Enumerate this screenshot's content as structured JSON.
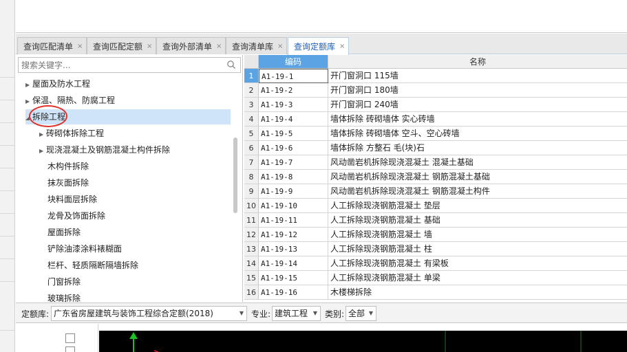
{
  "tabs": [
    {
      "label": "查询匹配清单",
      "active": false
    },
    {
      "label": "查询匹配定额",
      "active": false
    },
    {
      "label": "查询外部清单",
      "active": false
    },
    {
      "label": "查询清单库",
      "active": false
    },
    {
      "label": "查询定额库",
      "active": true
    }
  ],
  "tab_close_glyph": "×",
  "search": {
    "placeholder": "搜索关键字..."
  },
  "tree": [
    {
      "label": "屋面及防水工程",
      "level": 1,
      "expandable": true,
      "expanded": false
    },
    {
      "label": "保温、隔热、防腐工程",
      "level": 1,
      "expandable": true,
      "expanded": false
    },
    {
      "label": "拆除工程",
      "level": 1,
      "expandable": true,
      "expanded": true,
      "selected": true
    },
    {
      "label": "砖砌体拆除工程",
      "level": 2,
      "expandable": true,
      "expanded": false
    },
    {
      "label": "现浇混凝土及钢筋混凝土构件拆除",
      "level": 2,
      "expandable": true,
      "expanded": false
    },
    {
      "label": "木构件拆除",
      "level": 2,
      "expandable": false
    },
    {
      "label": "抹灰面拆除",
      "level": 2,
      "expandable": false
    },
    {
      "label": "块料面层拆除",
      "level": 2,
      "expandable": false
    },
    {
      "label": "龙骨及饰面拆除",
      "level": 2,
      "expandable": false
    },
    {
      "label": "屋面拆除",
      "level": 2,
      "expandable": false
    },
    {
      "label": "铲除油漆涂料裱糊面",
      "level": 2,
      "expandable": false
    },
    {
      "label": "栏杆、轻质隔断隔墙拆除",
      "level": 2,
      "expandable": false
    },
    {
      "label": "门窗拆除",
      "level": 2,
      "expandable": false
    },
    {
      "label": "玻璃拆除",
      "level": 2,
      "expandable": false
    }
  ],
  "grid": {
    "headers": {
      "code": "编码",
      "name": "名称"
    },
    "rows": [
      {
        "num": "1",
        "code": "A1-19-1",
        "name": "开门窗洞口 115墙"
      },
      {
        "num": "2",
        "code": "A1-19-2",
        "name": "开门窗洞口 180墙"
      },
      {
        "num": "3",
        "code": "A1-19-3",
        "name": "开门窗洞口 240墙"
      },
      {
        "num": "4",
        "code": "A1-19-4",
        "name": "墙体拆除 砖砌墙体 实心砖墙"
      },
      {
        "num": "5",
        "code": "A1-19-5",
        "name": "墙体拆除 砖砌墙体 空斗、空心砖墙"
      },
      {
        "num": "6",
        "code": "A1-19-6",
        "name": "墙体拆除 方整石 毛(块)石"
      },
      {
        "num": "7",
        "code": "A1-19-7",
        "name": "风动凿岩机拆除现浇混凝土 混凝土基础"
      },
      {
        "num": "8",
        "code": "A1-19-8",
        "name": "风动凿岩机拆除现浇混凝土 钢筋混凝土基础"
      },
      {
        "num": "9",
        "code": "A1-19-9",
        "name": "风动凿岩机拆除现浇混凝土 钢筋混凝土构件"
      },
      {
        "num": "10",
        "code": "A1-19-10",
        "name": "人工拆除现浇钢筋混凝土 垫层"
      },
      {
        "num": "11",
        "code": "A1-19-11",
        "name": "人工拆除现浇钢筋混凝土 基础"
      },
      {
        "num": "12",
        "code": "A1-19-12",
        "name": "人工拆除现浇钢筋混凝土 墙"
      },
      {
        "num": "13",
        "code": "A1-19-13",
        "name": "人工拆除现浇钢筋混凝土 柱"
      },
      {
        "num": "14",
        "code": "A1-19-14",
        "name": "人工拆除现浇钢筋混凝土 有梁板"
      },
      {
        "num": "15",
        "code": "A1-19-15",
        "name": "人工拆除现浇钢筋混凝土 单梁"
      },
      {
        "num": "16",
        "code": "A1-19-16",
        "name": "木楼梯拆除"
      }
    ]
  },
  "filters": {
    "quota_label": "定额库:",
    "quota_value": "广东省房屋建筑与装饰工程综合定额(2018)",
    "major_label": "专业:",
    "major_value": "建筑工程",
    "category_label": "类别:",
    "category_value": "全部"
  },
  "colors": {
    "accent": "#5ba3e2",
    "selection": "#cfe4f8",
    "annotation": "#e0322b"
  }
}
